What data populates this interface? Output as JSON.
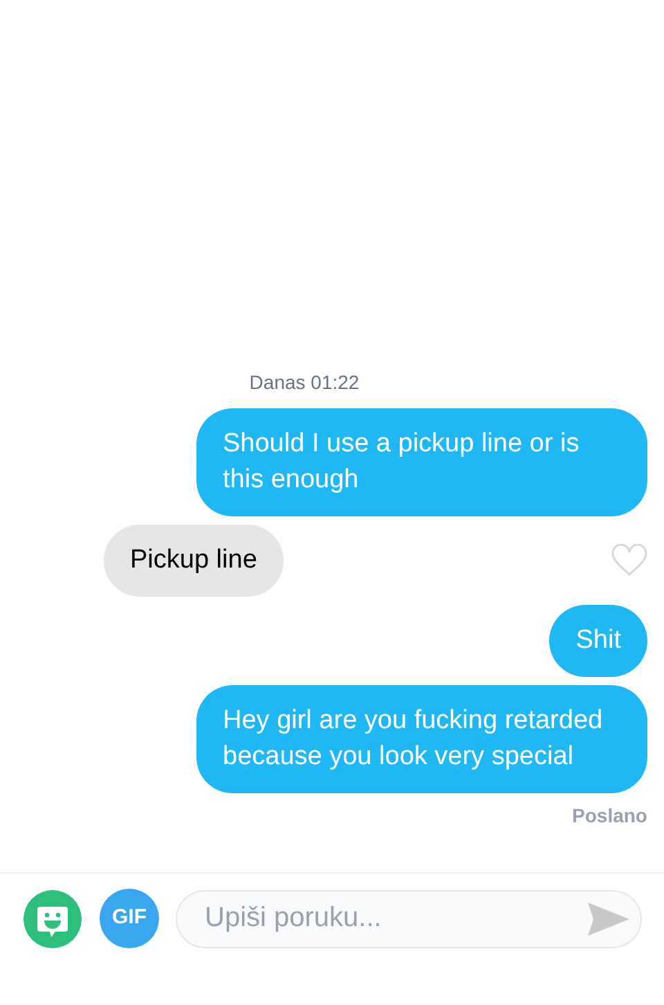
{
  "timestamp": "Danas 01:22",
  "messages": [
    {
      "kind": "sent",
      "text": "Should I use a pickup line or is this enough"
    },
    {
      "kind": "received",
      "text": "Pickup line",
      "liked": false
    },
    {
      "kind": "sent",
      "text": "Shit"
    },
    {
      "kind": "sent",
      "text": "Hey girl are you fucking retarded because you look very special"
    }
  ],
  "delivery_status": "Poslano",
  "composer": {
    "gif_label": "GIF",
    "placeholder": "Upiši poruku..."
  }
}
